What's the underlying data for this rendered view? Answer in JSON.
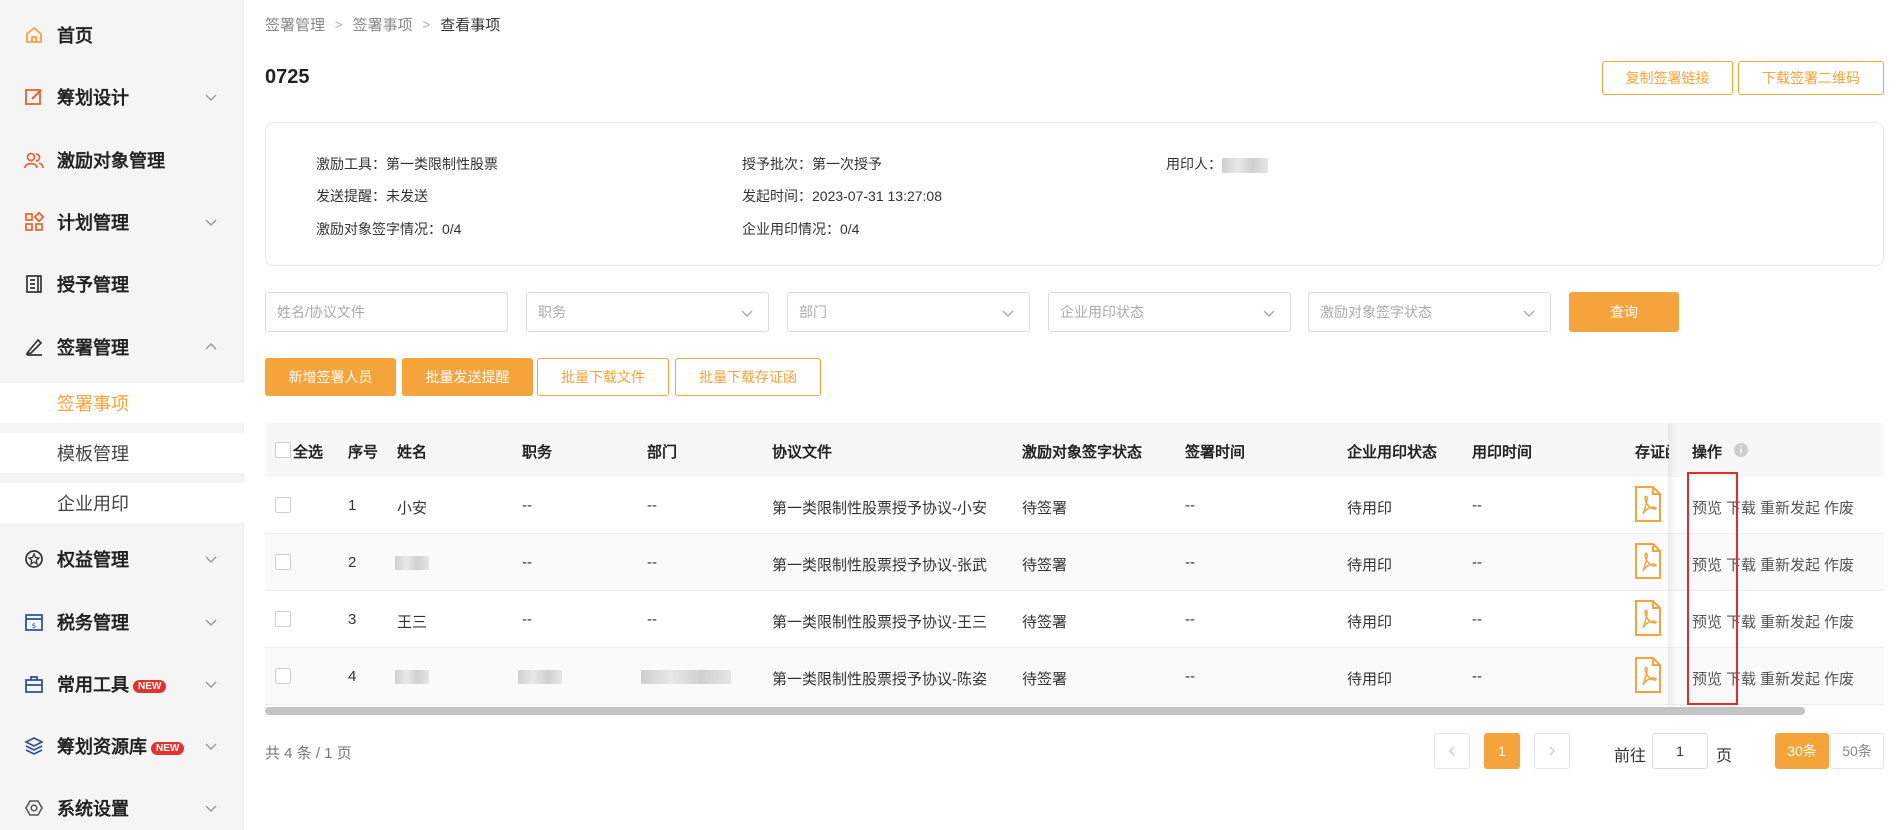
{
  "sidebar": {
    "items": [
      {
        "label": "首页",
        "icon": "home-icon"
      },
      {
        "label": "筹划设计",
        "icon": "edit-square-icon"
      },
      {
        "label": "激励对象管理",
        "icon": "users-icon"
      },
      {
        "label": "计划管理",
        "icon": "grid-apps-icon"
      },
      {
        "label": "授予管理",
        "icon": "ledger-icon"
      },
      {
        "label": "签署管理",
        "icon": "sign-pen-icon"
      },
      {
        "label": "权益管理",
        "icon": "badge-star-icon"
      },
      {
        "label": "税务管理",
        "icon": "tax-calc-icon"
      },
      {
        "label": "常用工具",
        "icon": "toolbox-icon",
        "badge": "NEW"
      },
      {
        "label": "筹划资源库",
        "icon": "layers-icon",
        "badge": "NEW"
      },
      {
        "label": "系统设置",
        "icon": "settings-hex-icon"
      }
    ],
    "sub_items": [
      {
        "label": "签署事项",
        "active": true
      },
      {
        "label": "模板管理"
      },
      {
        "label": "企业用印"
      }
    ]
  },
  "breadcrumb": [
    "签署管理",
    "签署事项",
    "查看事项"
  ],
  "page_title": "0725",
  "header_buttons": {
    "copy_link": "复制签署链接",
    "download_qr": "下载签署二维码"
  },
  "info": {
    "tool_label": "激励工具：",
    "tool_value": "第一类限制性股票",
    "batch_label": "授予批次：",
    "batch_value": "第一次授予",
    "sealer_label": "用印人：",
    "reminder_label": "发送提醒：",
    "reminder_value": "未发送",
    "start_label": "发起时间：",
    "start_value": "2023-07-31 13:27:08",
    "sign_status_label": "激励对象签字情况：",
    "sign_status_value": "0/4",
    "seal_status_label": "企业用印情况：",
    "seal_status_value": "0/4"
  },
  "filters": {
    "name_placeholder": "姓名/协议文件",
    "position_placeholder": "职务",
    "department_placeholder": "部门",
    "seal_status_placeholder": "企业用印状态",
    "sign_status_placeholder": "激励对象签字状态",
    "query_button": "查询"
  },
  "actions": {
    "add_signer": "新增签署人员",
    "batch_remind": "批量发送提醒",
    "batch_download_files": "批量下载文件",
    "batch_download_certs": "批量下载存证函"
  },
  "table": {
    "columns": {
      "select_all": "全选",
      "index": "序号",
      "name": "姓名",
      "position": "职务",
      "department": "部门",
      "agreement": "协议文件",
      "sign_status": "激励对象签字状态",
      "sign_time": "签署时间",
      "seal_status": "企业用印状态",
      "seal_time": "用印时间",
      "certificate": "存证函",
      "operations": "操作"
    },
    "rows": [
      {
        "index": "1",
        "name": "小安",
        "position": "--",
        "department": "--",
        "agreement": "第一类限制性股票授予协议-小安",
        "sign_status": "待签署",
        "sign_time": "--",
        "seal_status": "待用印",
        "seal_time": "--"
      },
      {
        "index": "2",
        "name": "",
        "position": "--",
        "department": "--",
        "agreement": "第一类限制性股票授予协议-张武",
        "sign_status": "待签署",
        "sign_time": "--",
        "seal_status": "待用印",
        "seal_time": "--"
      },
      {
        "index": "3",
        "name": "王三",
        "position": "--",
        "department": "--",
        "agreement": "第一类限制性股票授予协议-王三",
        "sign_status": "待签署",
        "sign_time": "--",
        "seal_status": "待用印",
        "seal_time": "--"
      },
      {
        "index": "4",
        "name": "",
        "position": "",
        "department": "",
        "agreement": "第一类限制性股票授予协议-陈姿",
        "sign_status": "待签署",
        "sign_time": "--",
        "seal_status": "待用印",
        "seal_time": "--"
      }
    ],
    "ops": {
      "preview": "预览",
      "download": "下载",
      "resend": "重新发起",
      "void": "作废"
    }
  },
  "pagination": {
    "total_text": "共 4 条 / 1 页",
    "current_page": "1",
    "goto_label": "前往",
    "goto_value": "1",
    "page_suffix": "页",
    "size_30": "30条",
    "size_50": "50条"
  },
  "colors": {
    "accent": "#f5a33b",
    "highlight": "#e42a2a"
  }
}
